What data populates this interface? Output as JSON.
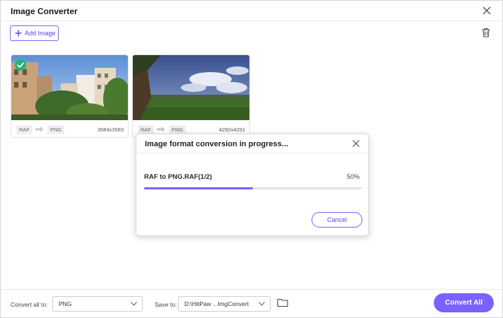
{
  "window": {
    "title": "Image Converter"
  },
  "toolbar": {
    "add_image_label": "Add Image"
  },
  "images": [
    {
      "from_format": "RAF",
      "to_format": "PNG",
      "dimensions": "3584x3583",
      "converted": true
    },
    {
      "from_format": "RAF",
      "to_format": "PNG",
      "dimensions": "4292x4291",
      "converted": false
    }
  ],
  "dialog": {
    "title": "Image format conversion in progress...",
    "progress_label": "RAF to PNG.RAF(1/2)",
    "progress_percent": "50%",
    "progress_fraction": 0.5,
    "cancel_label": "Cancel"
  },
  "footer": {
    "convert_all_label": "Convert all to:",
    "convert_all_value": "PNG",
    "save_to_label": "Save to:",
    "save_to_value": "D:\\HitPaw ...ImgConvert",
    "convert_button_label": "Convert All"
  },
  "colors": {
    "accent": "#7b61ff",
    "success": "#22b573"
  }
}
